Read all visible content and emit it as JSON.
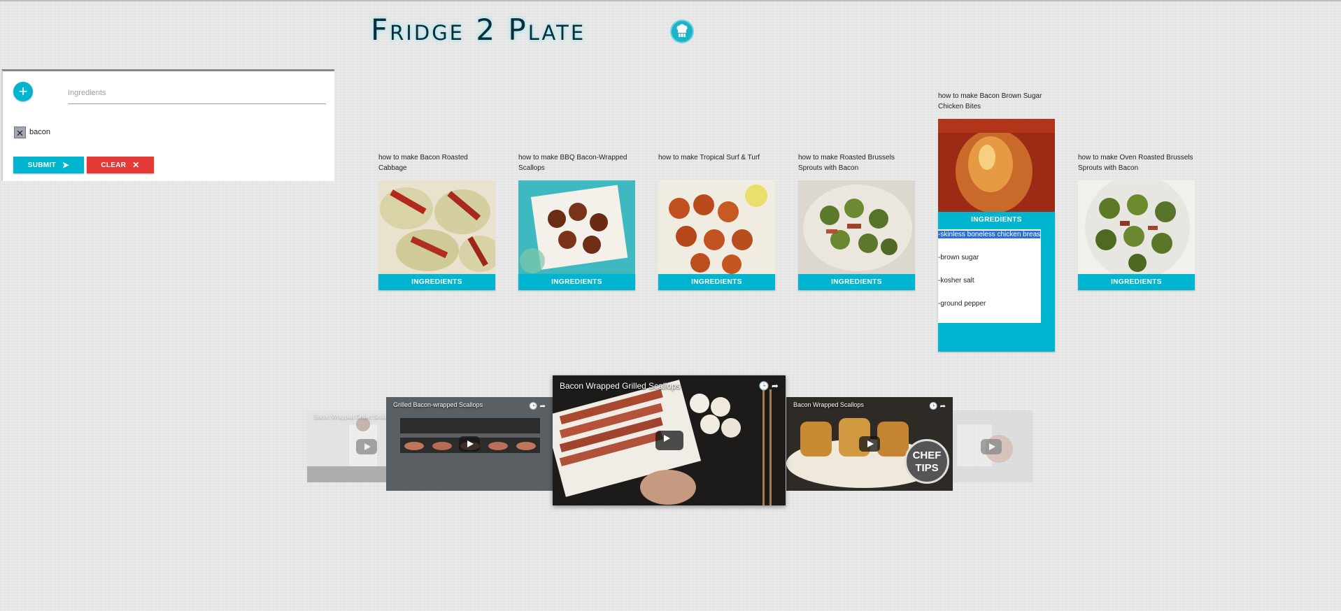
{
  "app": {
    "title": "Fridge 2 Plate",
    "logo_icon": "chef-hat-icon"
  },
  "search": {
    "add_icon": "+",
    "placeholder": "Ingredients",
    "value": "",
    "chips": [
      {
        "label": "bacon",
        "remove_icon": "✕"
      }
    ],
    "submit_label": "SUBMIT",
    "submit_icon": "➤",
    "clear_label": "CLEAR",
    "clear_icon": "✕"
  },
  "recipes": [
    {
      "title": "how to make Bacon Roasted Cabbage",
      "button": "INGREDIENTS"
    },
    {
      "title": "how to make BBQ Bacon-Wrapped Scallops",
      "button": "INGREDIENTS"
    },
    {
      "title": "how to make Tropical Surf & Turf",
      "button": "INGREDIENTS"
    },
    {
      "title": "how to make Roasted Brussels Sprouts with Bacon",
      "button": "INGREDIENTS"
    },
    {
      "title": "how to make Bacon Brown Sugar Chicken Bites",
      "button": "INGREDIENTS",
      "ingredients": [
        "-skinless boneless chicken breas",
        "-brown sugar",
        "-kosher salt",
        "-ground pepper"
      ]
    },
    {
      "title": "how to make Oven Roasted Brussels Sprouts with Bacon",
      "button": "INGREDIENTS"
    }
  ],
  "videos": [
    {
      "title": "Bacon Wrapped Grilled Scallops"
    },
    {
      "title": "Grilled Bacon-wrapped Scallops"
    },
    {
      "title": "Bacon Wrapped Grilled Scallops"
    },
    {
      "title": "Bacon Wrapped Scallops",
      "badge": "CHEF TIPS"
    },
    {
      "title": ""
    }
  ],
  "video_icons": "🕒 ➦",
  "colors": {
    "accent": "#00b5d0",
    "danger": "#e53935",
    "title_glow": "#7fe7f5"
  }
}
